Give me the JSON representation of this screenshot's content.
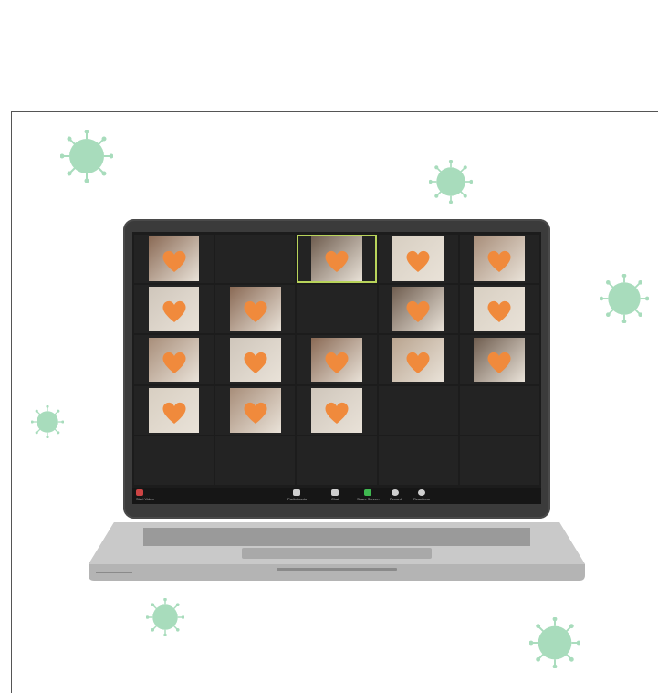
{
  "colors": {
    "background": "#ffffff",
    "virus": "#a8dcbc",
    "laptop_body": "#3b3b3b",
    "screen": "#1c1c1c",
    "heart": "#f08a3c",
    "active_speaker_border": "#b8d35a",
    "share_screen_green": "#3fb950"
  },
  "icons": [
    "virus-icon",
    "heart-icon",
    "laptop-illustration"
  ],
  "video_tiles": [
    {
      "has_video": true,
      "heart": true
    },
    {
      "has_video": false,
      "heart": false
    },
    {
      "has_video": true,
      "heart": true,
      "active_speaker": true
    },
    {
      "has_video": true,
      "heart": true
    },
    {
      "has_video": true,
      "heart": true
    },
    {
      "has_video": true,
      "heart": true
    },
    {
      "has_video": true,
      "heart": true
    },
    {
      "has_video": false,
      "heart": false
    },
    {
      "has_video": true,
      "heart": true
    },
    {
      "has_video": true,
      "heart": true
    },
    {
      "has_video": true,
      "heart": true
    },
    {
      "has_video": true,
      "heart": true
    },
    {
      "has_video": true,
      "heart": true
    },
    {
      "has_video": true,
      "heart": true
    },
    {
      "has_video": true,
      "heart": true
    },
    {
      "has_video": true,
      "heart": true
    },
    {
      "has_video": true,
      "heart": true
    },
    {
      "has_video": true,
      "heart": true
    },
    {
      "has_video": false,
      "heart": false
    },
    {
      "has_video": false,
      "heart": false
    },
    {
      "has_video": false,
      "heart": false
    },
    {
      "has_video": false,
      "heart": false
    },
    {
      "has_video": false,
      "heart": false
    },
    {
      "has_video": false,
      "heart": false
    },
    {
      "has_video": false,
      "heart": false
    }
  ],
  "toolbar": {
    "start_video": "Start Video",
    "participants": "Participants",
    "chat": "Chat",
    "share_screen": "Share Screen",
    "record": "Record",
    "reactions": "Reactions"
  }
}
